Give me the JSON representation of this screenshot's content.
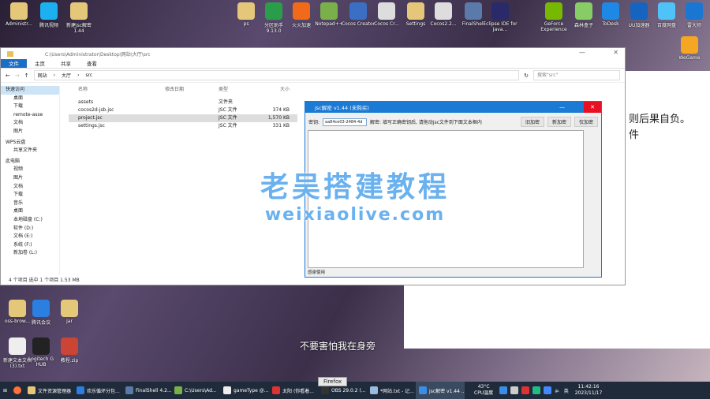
{
  "desktop_icons_top": [
    "Administr...",
    "腾讯视频",
    "新建jsc解密 1.44",
    "ps",
    "分区助手 9.13.0",
    "火火加速",
    "Notepad++",
    "Cocos Creator",
    "Cocos Cr...",
    "Settings",
    "Cocos2.2...",
    "FinalShell",
    "Eclipse IDE for Java...",
    "GeForce Experience",
    "森林盒子",
    "ToDesk",
    "UU加速器",
    "百度网盘",
    "雷大师"
  ],
  "desktop_icons_left": [
    "oss-brow...",
    "腾讯会议",
    "jar",
    "新建文本文档 (3).txt",
    "Logitech G HUB",
    "教程.zip"
  ],
  "background_window": {
    "line1": "则后果自负。",
    "line2": "件",
    "right_icons": [
      "WeGame"
    ]
  },
  "explorer": {
    "path_title": "C:\\Users\\Administrator\\Desktop\\网站\\大厅\\src",
    "ribbon": [
      "文件",
      "主页",
      "共享",
      "查看"
    ],
    "breadcrumb": [
      "网站",
      "大厅",
      "src"
    ],
    "search_placeholder": "搜索\"src\"",
    "nav": [
      "快速访问",
      "桌面",
      "下载",
      "remote-asse",
      "文档",
      "图片",
      "WPS云盘",
      "共享文件夹",
      "此电脑",
      "视频",
      "图片",
      "文档",
      "下载",
      "音乐",
      "桌面",
      "本地磁盘 (C:)",
      "软件 (D:)",
      "文档 (E:)",
      "系统 (F:)",
      "新加卷 (L:)"
    ],
    "columns": [
      "名称",
      "修改日期",
      "类型",
      "大小"
    ],
    "files": [
      {
        "name": "assets",
        "type": "文件夹",
        "size": ""
      },
      {
        "name": "cocos2d-jsb.jsc",
        "type": "JSC 文件",
        "size": "374 KB"
      },
      {
        "name": "project.jsc",
        "type": "JSC 文件",
        "size": "1,570 KB"
      },
      {
        "name": "settings.jsc",
        "type": "JSC 文件",
        "size": "331 KB"
      }
    ],
    "status": "4 个项目    选中 1 个项目  1.53 MB"
  },
  "dialog": {
    "title": "jsc解密 v1.44 (未购买)",
    "key_label": "密钥:",
    "key_value": "aa84ce03-2484-4d",
    "hint": "解密: 填写正确密钥后, 请拖动jsc文件到下面文本框内",
    "buttons": [
      "旧加密",
      "新加密",
      "仅加密"
    ],
    "footer": "感谢使用"
  },
  "watermark": {
    "line1": "老吴搭建教程",
    "line2": "weixiaolive.com"
  },
  "subtitle": "不要害怕我在身旁",
  "tooltip": "Firefox",
  "taskbar": {
    "items": [
      "文件资源管理器",
      "欢乐循环分包...",
      "FinalShell 4.2...",
      "C:\\Users\\Ad...",
      "gameType @...",
      "太阳 (你看着...",
      "OBS 29.0.2 (...",
      "*网站.txt - 记...",
      "jsc解密 v1.44 ..."
    ],
    "temp": "43°C",
    "temp_label": "CPU温度",
    "lang": "英",
    "time": "11:42:16",
    "date": "2023/11/17"
  }
}
